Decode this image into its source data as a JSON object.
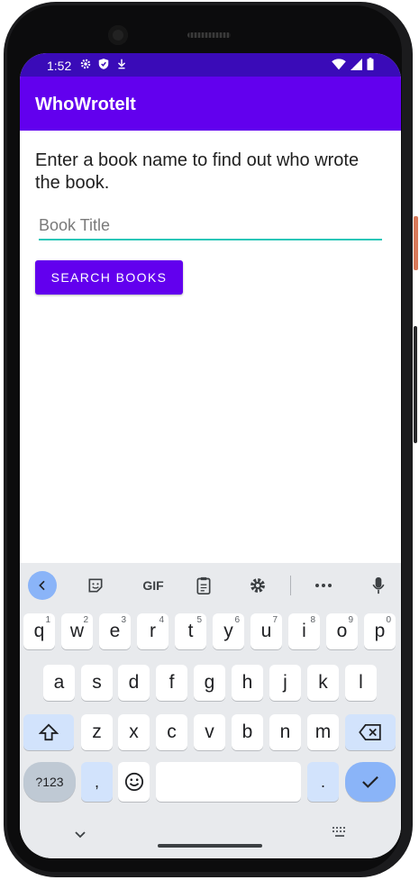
{
  "status": {
    "time": "1:52",
    "left_icons": [
      "gear-icon",
      "shield-icon",
      "download-icon"
    ],
    "right_icons": [
      "wifi-icon",
      "signal-icon",
      "battery-icon"
    ]
  },
  "app": {
    "title": "WhoWroteIt",
    "instruction": "Enter a book name to find out who wrote the book.",
    "input": {
      "placeholder": "Book Title",
      "value": ""
    },
    "search_label": "SEARCH BOOKS"
  },
  "keyboard": {
    "toolbar": [
      "chevron-left-icon",
      "sticker-icon",
      "gif-icon",
      "clipboard-icon",
      "gear-icon",
      "more-icon",
      "microphone-icon"
    ],
    "gif_label": "GIF",
    "row1": [
      {
        "key": "q",
        "hint": "1"
      },
      {
        "key": "w",
        "hint": "2"
      },
      {
        "key": "e",
        "hint": "3"
      },
      {
        "key": "r",
        "hint": "4"
      },
      {
        "key": "t",
        "hint": "5"
      },
      {
        "key": "y",
        "hint": "6"
      },
      {
        "key": "u",
        "hint": "7"
      },
      {
        "key": "i",
        "hint": "8"
      },
      {
        "key": "o",
        "hint": "9"
      },
      {
        "key": "p",
        "hint": "0"
      }
    ],
    "row2": [
      "a",
      "s",
      "d",
      "f",
      "g",
      "h",
      "j",
      "k",
      "l"
    ],
    "row3": [
      "z",
      "x",
      "c",
      "v",
      "b",
      "n",
      "m"
    ],
    "symbols_label": "?123",
    "comma_label": ",",
    "period_label": "."
  },
  "colors": {
    "primary": "#6200ee",
    "status_bar": "#3a0bb8",
    "accent_underline": "#26c6b8",
    "keyboard_bg": "#e8eaed",
    "key_highlight": "#8ab4f8"
  }
}
